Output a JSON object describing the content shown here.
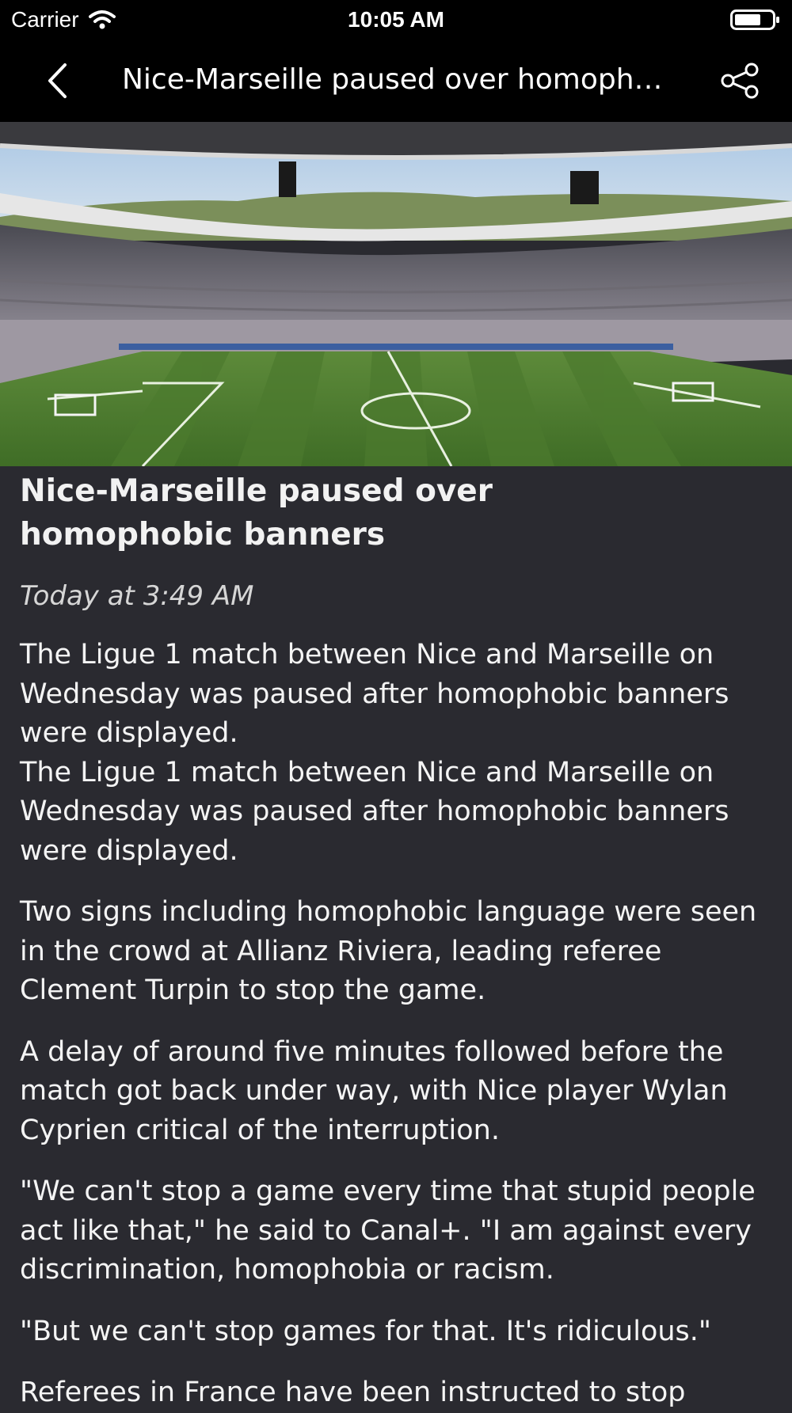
{
  "status_bar": {
    "carrier": "Carrier",
    "time": "10:05 AM",
    "icons": [
      "wifi-icon",
      "battery-icon"
    ]
  },
  "nav": {
    "title": "Nice-Marseille paused over homophobi...",
    "back_icon": "chevron-left-icon",
    "share_icon": "share-icon"
  },
  "hero_image": {
    "description": "stadium-photo"
  },
  "article": {
    "headline": "Nice-Marseille paused over homophobic banners",
    "timestamp": "Today at 3:49 AM",
    "paragraphs": [
      "The Ligue 1 match between Nice and Marseille on Wednesday was paused after homophobic banners were displayed.",
      "The Ligue 1 match between Nice and Marseille on Wednesday was paused after homophobic banners were displayed.",
      "Two signs including homophobic language were seen in the crowd at Allianz Riviera, leading referee Clement Turpin to stop the game.",
      "A delay of around five minutes followed before the match got back under way, with Nice player Wylan Cyprien critical of the interruption.",
      "\"We can't stop a game every time that stupid people act like that,\" he said to Canal+. \"I am against every discrimination, homophobia or racism.",
      "\"But we can't stop games for that. It's ridiculous.\"",
      "Referees in France have been instructed to stop"
    ]
  },
  "colors": {
    "background": "#2a2a30",
    "bars": "#000000",
    "text": "#f2f2f2"
  }
}
